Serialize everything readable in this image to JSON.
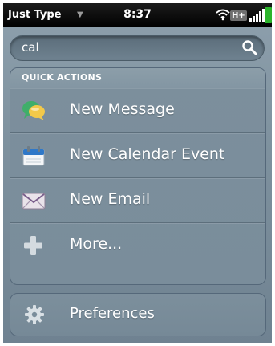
{
  "status_bar": {
    "app_title": "Just Type",
    "time": "8:37",
    "network": "H+",
    "icons": [
      "app-menu-arrow-icon",
      "wifi-icon",
      "signal-icon",
      "battery-icon"
    ]
  },
  "search": {
    "value": "cal",
    "icon": "search-icon"
  },
  "quick_actions": {
    "header": "QUICK ACTIONS",
    "items": [
      {
        "label": "New Message",
        "icon": "chat-bubbles-icon"
      },
      {
        "label": "New Calendar Event",
        "icon": "calendar-icon"
      },
      {
        "label": "New Email",
        "icon": "envelope-icon"
      },
      {
        "label": "More...",
        "icon": "plus-icon"
      }
    ]
  },
  "preferences": {
    "label": "Preferences",
    "icon": "gear-icon"
  },
  "colors": {
    "screen_bg": "#8ea0ad",
    "status_bar_bg": "#000000",
    "battery": "#2cb42c",
    "text": "#ffffff"
  }
}
